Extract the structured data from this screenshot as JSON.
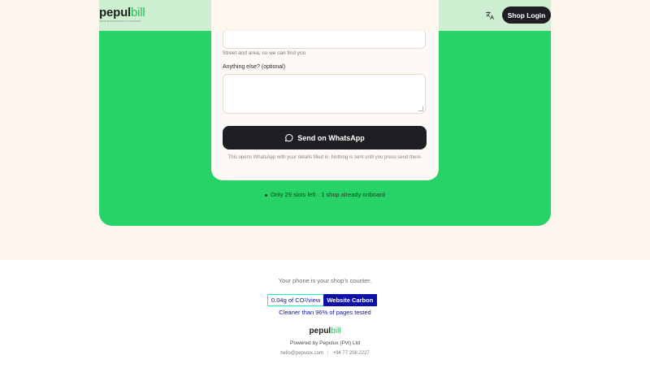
{
  "nav": {
    "logo_main": "pepul",
    "logo_accent": "bill",
    "logo_tagline": "SHOP MANAGEMENT SOFTWARE",
    "translate_icon": "translate-icon",
    "login_label": "Shop Login"
  },
  "form": {
    "street_hint": "Street and area, so we can find you",
    "else_label": "Anything else? (optional)",
    "send_label": "Send on WhatsApp",
    "send_icon": "whatsapp-chat-icon",
    "note": "This opens WhatsApp with your details filled in. Nothing is sent until you press send there."
  },
  "slots": {
    "text": "Only 29 slots left · 1 shop already onboard"
  },
  "footer": {
    "tagline": "Your phone is your shop's counter.",
    "carbon_value": "0.04g of CO",
    "carbon_sub": "2",
    "carbon_unit": "/view",
    "carbon_brand": "Website Carbon",
    "cleaner": "Cleaner than 96% of pages tested",
    "logo_main": "pepul",
    "logo_accent": "bill",
    "powered": "Powered by Pepulux (Pvt) Ltd",
    "email": "hello@pepulux.com",
    "separator": "|",
    "phone": "+94 77 208 2227"
  },
  "colors": {
    "green_panel": "#27d366",
    "dark_button": "#1e1f22",
    "carbon_blue": "#0e11a8",
    "background": "#fdf6ee"
  }
}
